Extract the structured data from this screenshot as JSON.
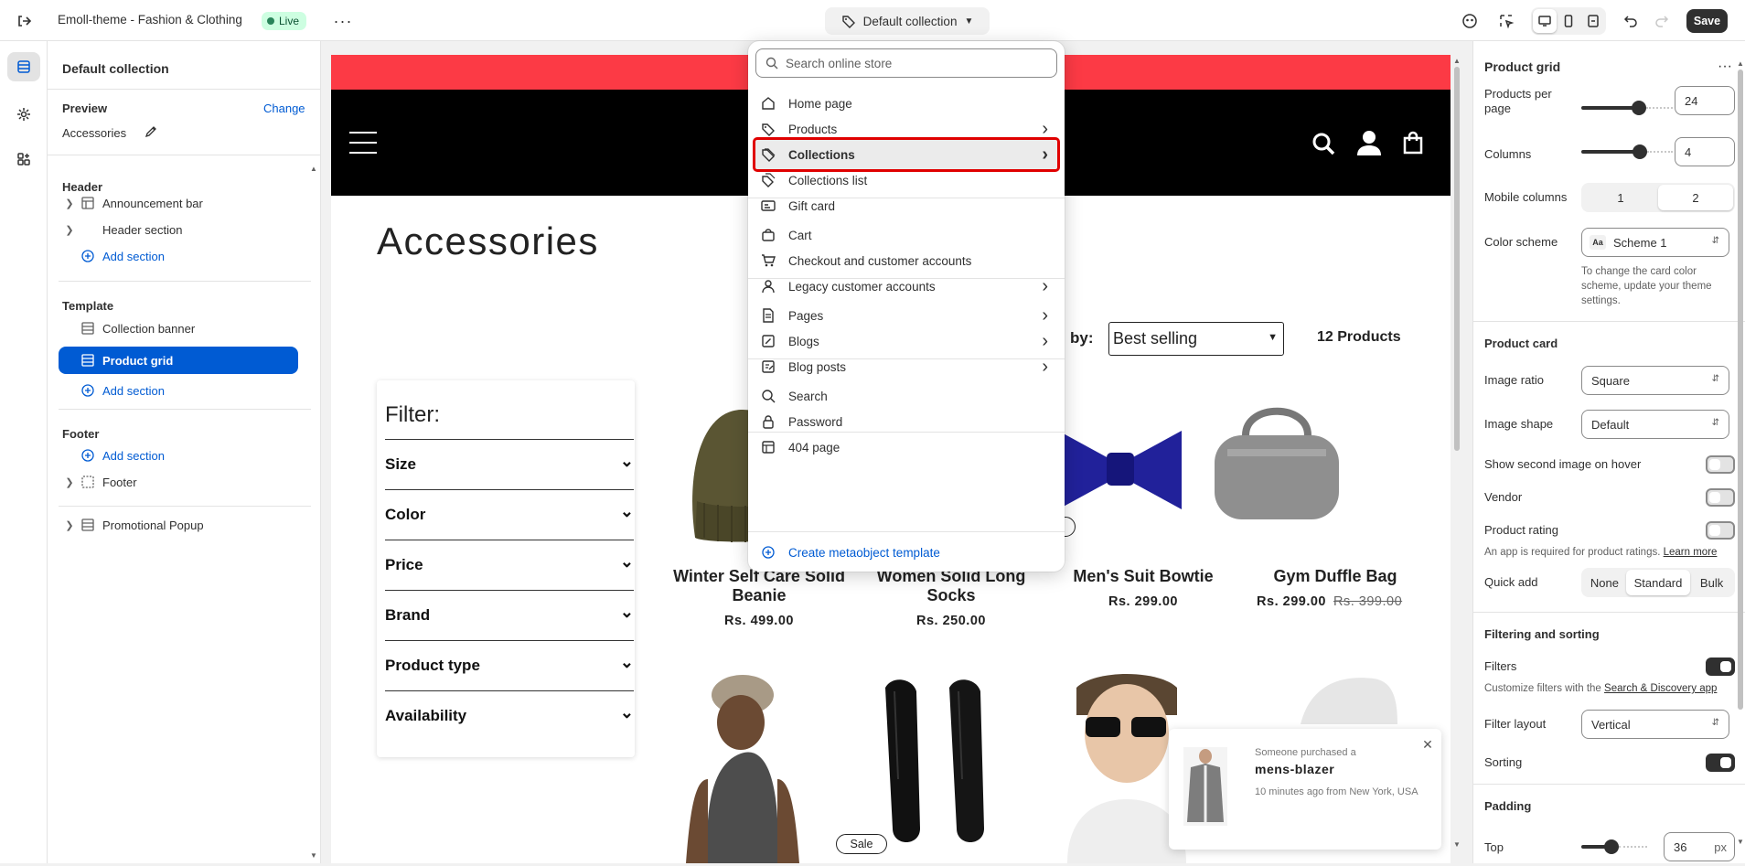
{
  "topbar": {
    "theme_name": "Emoll-theme - Fashion & Clothing",
    "live_badge": "Live",
    "template_selector": "Default collection",
    "save_label": "Save"
  },
  "left_panel": {
    "title": "Default collection",
    "preview_label": "Preview",
    "change_link": "Change",
    "preview_value": "Accessories",
    "header_group": "Header",
    "header_items": [
      "Announcement bar",
      "Header section"
    ],
    "add_section": "Add section",
    "template_group": "Template",
    "template_items": [
      "Collection banner",
      "Product grid"
    ],
    "footer_group": "Footer",
    "footer_items": [
      "Footer"
    ],
    "popup_item": "Promotional Popup"
  },
  "dropdown": {
    "search_placeholder": "Search online store",
    "items": [
      {
        "label": "Home page",
        "icon": "home-icon",
        "has_submenu": false
      },
      {
        "label": "Products",
        "icon": "tag-icon",
        "has_submenu": true
      },
      {
        "label": "Collections",
        "icon": "collection-icon",
        "has_submenu": true,
        "highlighted": true
      },
      {
        "label": "Collections list",
        "icon": "collection-list-icon",
        "has_submenu": false
      },
      {
        "label": "Gift card",
        "icon": "gift-card-icon",
        "has_submenu": false
      },
      {
        "label": "Cart",
        "icon": "bag-icon",
        "has_submenu": false
      },
      {
        "label": "Checkout and customer accounts",
        "icon": "cart-icon",
        "has_submenu": false
      },
      {
        "label": "Legacy customer accounts",
        "icon": "person-icon",
        "has_submenu": true
      },
      {
        "label": "Pages",
        "icon": "page-icon",
        "has_submenu": true
      },
      {
        "label": "Blogs",
        "icon": "blog-icon",
        "has_submenu": true
      },
      {
        "label": "Blog posts",
        "icon": "blog-post-icon",
        "has_submenu": true
      },
      {
        "label": "Search",
        "icon": "search-icon",
        "has_submenu": false
      },
      {
        "label": "Password",
        "icon": "lock-icon",
        "has_submenu": false
      },
      {
        "label": "404 page",
        "icon": "error-page-icon",
        "has_submenu": false
      }
    ],
    "create_label": "Create metaobject template"
  },
  "storefront": {
    "page_title": "Accessories",
    "sort_label": "by:",
    "sort_value": "Best selling",
    "product_count": "12 Products",
    "filter_title": "Filter:",
    "filters": [
      "Size",
      "Color",
      "Price",
      "Brand",
      "Product type",
      "Availability"
    ],
    "products": [
      {
        "name": "Winter Self Care Solid Beanie",
        "price": "Rs. 499.00",
        "compare": "",
        "sale": false
      },
      {
        "name": "Women Solid Long Socks",
        "price": "Rs. 250.00",
        "compare": "",
        "sale": false
      },
      {
        "name": "Men's Suit Bowtie",
        "price": "Rs. 299.00",
        "compare": "",
        "sale": false
      },
      {
        "name": "Gym Duffle Bag",
        "price": "Rs. 299.00",
        "compare": "Rs. 399.00",
        "sale": true
      }
    ],
    "sale_badge": "Sale",
    "popup": {
      "line1": "Someone purchased a",
      "product": "mens-blazer",
      "line3": "10 minutes ago from New York, USA"
    }
  },
  "right_panel": {
    "title": "Product grid",
    "products_per_page_label": "Products per page",
    "products_per_page": "24",
    "products_per_page_level": 0.65,
    "columns_label": "Columns",
    "columns": "4",
    "columns_level": 0.67,
    "mobile_columns_label": "Mobile columns",
    "mobile_columns_options": [
      "1",
      "2"
    ],
    "mobile_columns_selected": "2",
    "color_scheme_label": "Color scheme",
    "color_scheme_value": "Scheme 1",
    "color_scheme_help": "To change the card color scheme, update your theme settings.",
    "product_card_heading": "Product card",
    "image_ratio_label": "Image ratio",
    "image_ratio_value": "Square",
    "image_shape_label": "Image shape",
    "image_shape_value": "Default",
    "second_image_label": "Show second image on hover",
    "vendor_label": "Vendor",
    "rating_label": "Product rating",
    "rating_help": "An app is required for product ratings.",
    "learn_more": "Learn more",
    "quick_add_label": "Quick add",
    "quick_add_options": [
      "None",
      "Standard",
      "Bulk"
    ],
    "quick_add_selected": "Standard",
    "filtering_heading": "Filtering and sorting",
    "filters_label": "Filters",
    "filters_help_prefix": "Customize filters with the",
    "filters_help_link": "Search & Discovery app",
    "filter_layout_label": "Filter layout",
    "filter_layout_value": "Vertical",
    "sorting_label": "Sorting",
    "padding_heading": "Padding",
    "top_label": "Top",
    "top_value": "36",
    "top_unit": "px",
    "top_level": 0.45
  },
  "colors": {
    "accent": "#005bd3",
    "announcement_bar": "#fc3a45",
    "highlight_box": "#e00000",
    "live_badge_bg": "#cdfee1"
  }
}
